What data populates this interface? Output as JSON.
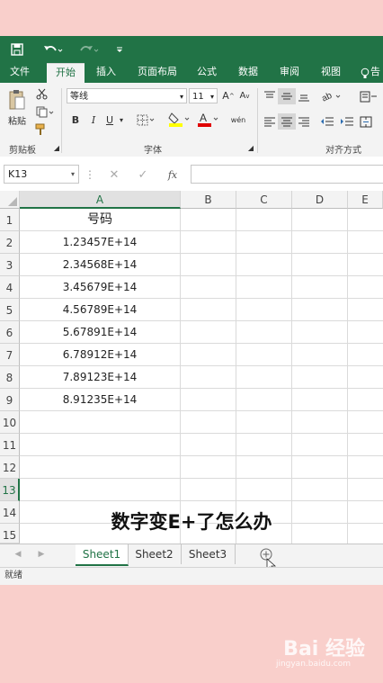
{
  "quick_access": {
    "save_icon": "save-icon",
    "undo_icon": "undo-icon",
    "redo_icon": "redo-icon",
    "customize_icon": "customize-icon"
  },
  "tabs": [
    {
      "label": "文件",
      "active": false
    },
    {
      "label": "开始",
      "active": true
    },
    {
      "label": "插入",
      "active": false
    },
    {
      "label": "页面布局",
      "active": false
    },
    {
      "label": "公式",
      "active": false
    },
    {
      "label": "数据",
      "active": false
    },
    {
      "label": "审阅",
      "active": false
    },
    {
      "label": "视图",
      "active": false
    },
    {
      "label": "告",
      "active": false
    }
  ],
  "ribbon": {
    "clipboard": {
      "paste_label": "粘贴",
      "group_label": "剪贴板"
    },
    "font": {
      "font_name": "等线",
      "font_size": "11",
      "bold": "B",
      "italic": "I",
      "underline": "U",
      "group_label": "字体",
      "phonetic": "wén"
    },
    "alignment": {
      "group_label": "对齐方式"
    }
  },
  "formula_bar": {
    "name_box": "K13",
    "fx": "fx",
    "formula": ""
  },
  "columns": [
    "A",
    "B",
    "C",
    "D",
    "E"
  ],
  "selected_column": "A",
  "rows": [
    "1",
    "2",
    "3",
    "4",
    "5",
    "6",
    "7",
    "8",
    "9",
    "10",
    "11",
    "12",
    "13",
    "14",
    "15"
  ],
  "selected_row": "13",
  "cells_a": [
    "号码",
    "1.23457E+14",
    "2.34568E+14",
    "3.45679E+14",
    "4.56789E+14",
    "5.67891E+14",
    "6.78912E+14",
    "7.89123E+14",
    "8.91235E+14"
  ],
  "caption": "数字变E+了怎么办",
  "sheets": [
    {
      "label": "Sheet1",
      "active": true
    },
    {
      "label": "Sheet2",
      "active": false
    },
    {
      "label": "Sheet3",
      "active": false
    }
  ],
  "status": "就绪",
  "watermark": {
    "main": "Bai 经验",
    "sub": "jingyan.baidu.com"
  },
  "colors": {
    "accent": "#217346",
    "background": "#f9cfcb"
  }
}
